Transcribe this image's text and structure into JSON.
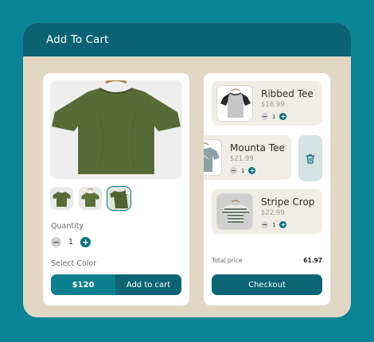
{
  "header": {
    "title": "Add To Cart"
  },
  "product": {
    "image_icon": "olive-tshirt",
    "thumbnails": [
      {
        "icon": "olive-tshirt-front",
        "active": false
      },
      {
        "icon": "olive-tshirt-folded",
        "active": false
      },
      {
        "icon": "olive-tshirt-hanger",
        "active": true
      }
    ],
    "quantity_label": "Quantity",
    "quantity": "1",
    "color_label": "Select Color",
    "price": "$120",
    "add_label": "Add to cart"
  },
  "cart": {
    "items": [
      {
        "name": "Ribbed Tee",
        "price": "$16.99",
        "qty": "1"
      },
      {
        "name": "Mounta Tee",
        "price": "$21.99",
        "qty": "1"
      },
      {
        "name": "Stripe Crop",
        "price": "$22.99",
        "qty": "1"
      }
    ],
    "delete_icon": "trash-icon",
    "total_label": "Total price",
    "total_value": "61.97",
    "checkout_label": "Checkout"
  },
  "colors": {
    "accent": "#0b7180",
    "dark": "#0a6473",
    "frame": "#0b8497",
    "shirt": "#556b35"
  }
}
